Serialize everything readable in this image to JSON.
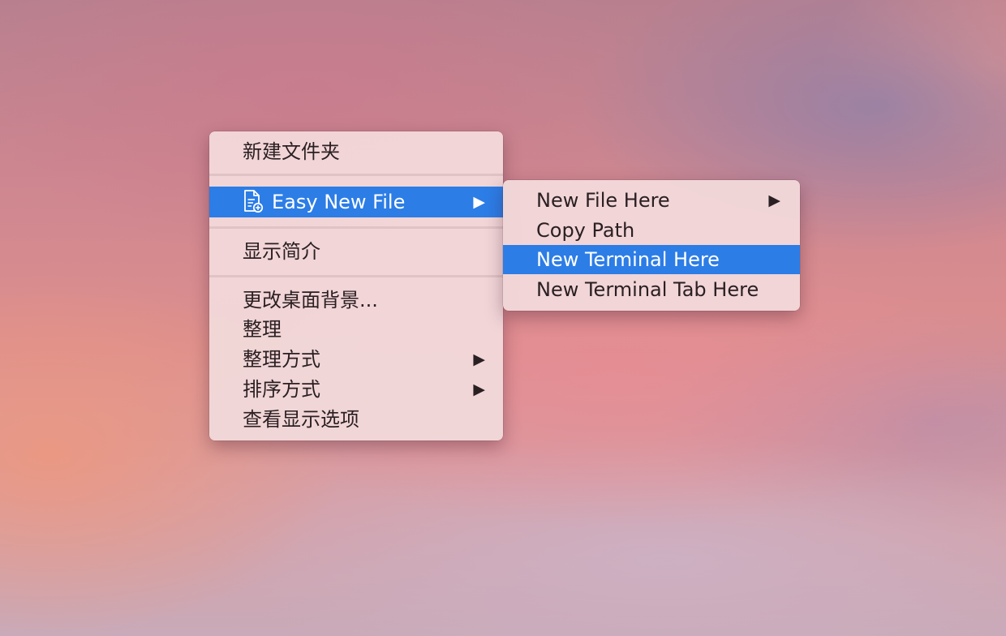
{
  "context_menu": {
    "items": [
      {
        "label": "新建文件夹"
      },
      {
        "label": "Easy New File",
        "icon": "new-file-icon",
        "submenu": true
      },
      {
        "label": "显示简介"
      },
      {
        "label": "更改桌面背景..."
      },
      {
        "label": "整理"
      },
      {
        "label": "整理方式",
        "submenu": true
      },
      {
        "label": "排序方式",
        "submenu": true
      },
      {
        "label": "查看显示选项"
      }
    ],
    "highlighted_index": 1
  },
  "submenu": {
    "items": [
      {
        "label": "New File Here",
        "submenu": true
      },
      {
        "label": "Copy Path"
      },
      {
        "label": "New Terminal Here"
      },
      {
        "label": "New Terminal Tab Here"
      }
    ],
    "highlighted_index": 2
  },
  "arrow_glyph": "▶",
  "colors": {
    "highlight": "#2c7de6",
    "menu_background": "#f2d8d9",
    "text": "#2a1f22"
  }
}
